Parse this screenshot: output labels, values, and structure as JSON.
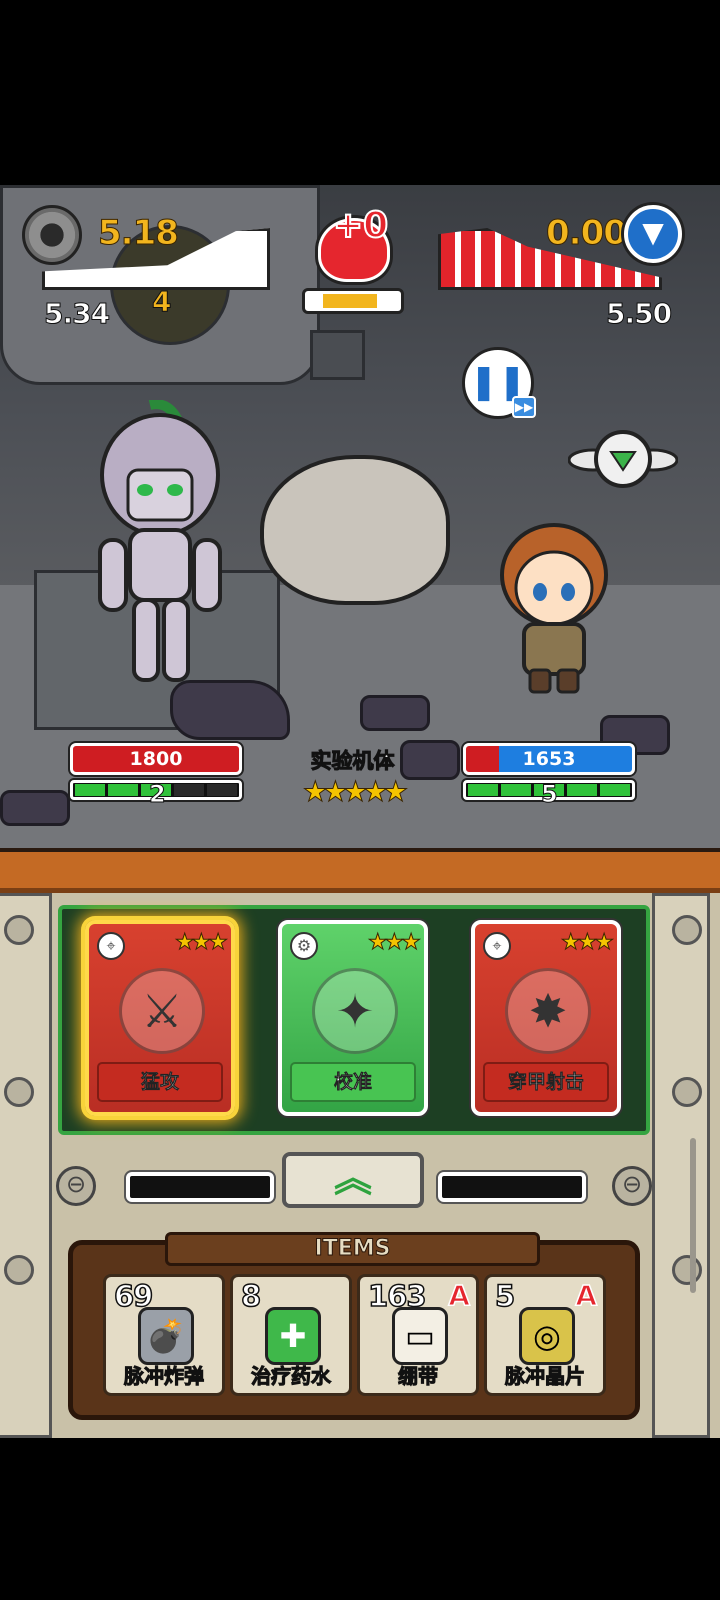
{
  "hud": {
    "left_top_value": "5.18",
    "left_bottom_value": "5.34",
    "wave_number": "4",
    "skull_value": "+0",
    "skull_progress": 0.85,
    "right_top_value": "0.00",
    "right_bottom_value": "5.50"
  },
  "battle": {
    "enemy_hp": "1800",
    "enemy_energy": "2",
    "enemy_energy_filled": 3,
    "enemy_name": "实验机体",
    "enemy_stars": "★★★★★",
    "player_hp": "1653",
    "player_energy": "5",
    "player_energy_filled": 5
  },
  "cards": [
    {
      "label": "猛攻",
      "stars": "★★★",
      "color": "red",
      "selected": true,
      "icon": "claw-icon"
    },
    {
      "label": "校准",
      "stars": "★★★",
      "color": "green",
      "selected": false,
      "icon": "cannon-icon"
    },
    {
      "label": "穿甲射击",
      "stars": "★★★",
      "color": "red",
      "selected": false,
      "icon": "rock-burst-icon"
    }
  ],
  "items": {
    "title": "ITEMS",
    "list": [
      {
        "count": "69",
        "label": "脉冲炸弹",
        "grade": "",
        "icon": "pulse-bomb-icon"
      },
      {
        "count": "8",
        "label": "治疗药水",
        "grade": "",
        "icon": "heal-potion-icon"
      },
      {
        "count": "163",
        "label": "绷带",
        "grade": "A",
        "icon": "bandage-icon"
      },
      {
        "count": "5",
        "label": "脉冲晶片",
        "grade": "A",
        "icon": "pulse-chip-icon"
      }
    ]
  },
  "colors": {
    "accent_gold": "#f2b51e",
    "hp_red": "#cf1d22",
    "hp_blue": "#1e7ee0",
    "energy_green": "#30c23a"
  }
}
